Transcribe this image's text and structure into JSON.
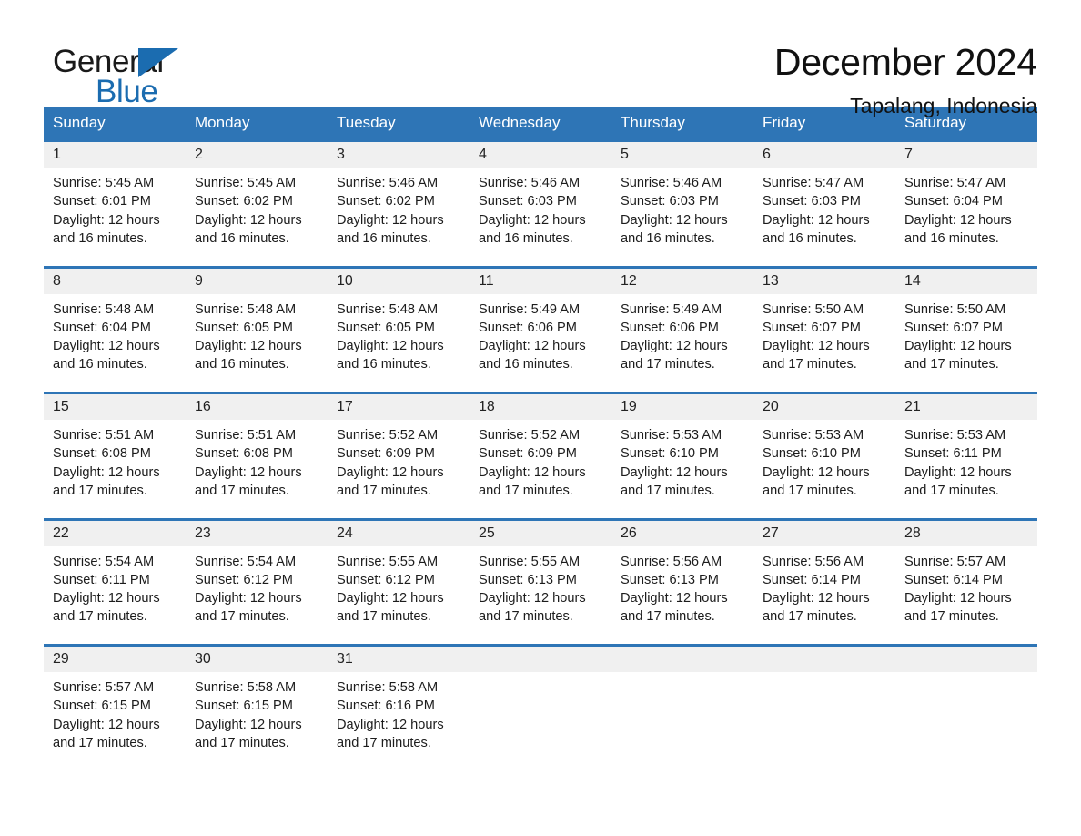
{
  "brand": {
    "word_one": "General",
    "word_two": "Blue",
    "accent_color": "#1b6cb0"
  },
  "header": {
    "title": "December 2024",
    "subtitle": "Tapalang, Indonesia"
  },
  "theme": {
    "header_blue": "#2e75b6",
    "daynum_background": "#f0f0f0",
    "text_color": "#1c1c1c"
  },
  "weekday_headers": [
    "Sunday",
    "Monday",
    "Tuesday",
    "Wednesday",
    "Thursday",
    "Friday",
    "Saturday"
  ],
  "labels": {
    "sunrise_prefix": "Sunrise:",
    "sunset_prefix": "Sunset:",
    "daylight_prefix": "Daylight:"
  },
  "weeks": [
    {
      "days": [
        {
          "date": "1",
          "sunrise": "Sunrise: 5:45 AM",
          "sunset": "Sunset: 6:01 PM",
          "daylight_line1": "Daylight: 12 hours",
          "daylight_line2": "and 16 minutes."
        },
        {
          "date": "2",
          "sunrise": "Sunrise: 5:45 AM",
          "sunset": "Sunset: 6:02 PM",
          "daylight_line1": "Daylight: 12 hours",
          "daylight_line2": "and 16 minutes."
        },
        {
          "date": "3",
          "sunrise": "Sunrise: 5:46 AM",
          "sunset": "Sunset: 6:02 PM",
          "daylight_line1": "Daylight: 12 hours",
          "daylight_line2": "and 16 minutes."
        },
        {
          "date": "4",
          "sunrise": "Sunrise: 5:46 AM",
          "sunset": "Sunset: 6:03 PM",
          "daylight_line1": "Daylight: 12 hours",
          "daylight_line2": "and 16 minutes."
        },
        {
          "date": "5",
          "sunrise": "Sunrise: 5:46 AM",
          "sunset": "Sunset: 6:03 PM",
          "daylight_line1": "Daylight: 12 hours",
          "daylight_line2": "and 16 minutes."
        },
        {
          "date": "6",
          "sunrise": "Sunrise: 5:47 AM",
          "sunset": "Sunset: 6:03 PM",
          "daylight_line1": "Daylight: 12 hours",
          "daylight_line2": "and 16 minutes."
        },
        {
          "date": "7",
          "sunrise": "Sunrise: 5:47 AM",
          "sunset": "Sunset: 6:04 PM",
          "daylight_line1": "Daylight: 12 hours",
          "daylight_line2": "and 16 minutes."
        }
      ]
    },
    {
      "days": [
        {
          "date": "8",
          "sunrise": "Sunrise: 5:48 AM",
          "sunset": "Sunset: 6:04 PM",
          "daylight_line1": "Daylight: 12 hours",
          "daylight_line2": "and 16 minutes."
        },
        {
          "date": "9",
          "sunrise": "Sunrise: 5:48 AM",
          "sunset": "Sunset: 6:05 PM",
          "daylight_line1": "Daylight: 12 hours",
          "daylight_line2": "and 16 minutes."
        },
        {
          "date": "10",
          "sunrise": "Sunrise: 5:48 AM",
          "sunset": "Sunset: 6:05 PM",
          "daylight_line1": "Daylight: 12 hours",
          "daylight_line2": "and 16 minutes."
        },
        {
          "date": "11",
          "sunrise": "Sunrise: 5:49 AM",
          "sunset": "Sunset: 6:06 PM",
          "daylight_line1": "Daylight: 12 hours",
          "daylight_line2": "and 16 minutes."
        },
        {
          "date": "12",
          "sunrise": "Sunrise: 5:49 AM",
          "sunset": "Sunset: 6:06 PM",
          "daylight_line1": "Daylight: 12 hours",
          "daylight_line2": "and 17 minutes."
        },
        {
          "date": "13",
          "sunrise": "Sunrise: 5:50 AM",
          "sunset": "Sunset: 6:07 PM",
          "daylight_line1": "Daylight: 12 hours",
          "daylight_line2": "and 17 minutes."
        },
        {
          "date": "14",
          "sunrise": "Sunrise: 5:50 AM",
          "sunset": "Sunset: 6:07 PM",
          "daylight_line1": "Daylight: 12 hours",
          "daylight_line2": "and 17 minutes."
        }
      ]
    },
    {
      "days": [
        {
          "date": "15",
          "sunrise": "Sunrise: 5:51 AM",
          "sunset": "Sunset: 6:08 PM",
          "daylight_line1": "Daylight: 12 hours",
          "daylight_line2": "and 17 minutes."
        },
        {
          "date": "16",
          "sunrise": "Sunrise: 5:51 AM",
          "sunset": "Sunset: 6:08 PM",
          "daylight_line1": "Daylight: 12 hours",
          "daylight_line2": "and 17 minutes."
        },
        {
          "date": "17",
          "sunrise": "Sunrise: 5:52 AM",
          "sunset": "Sunset: 6:09 PM",
          "daylight_line1": "Daylight: 12 hours",
          "daylight_line2": "and 17 minutes."
        },
        {
          "date": "18",
          "sunrise": "Sunrise: 5:52 AM",
          "sunset": "Sunset: 6:09 PM",
          "daylight_line1": "Daylight: 12 hours",
          "daylight_line2": "and 17 minutes."
        },
        {
          "date": "19",
          "sunrise": "Sunrise: 5:53 AM",
          "sunset": "Sunset: 6:10 PM",
          "daylight_line1": "Daylight: 12 hours",
          "daylight_line2": "and 17 minutes."
        },
        {
          "date": "20",
          "sunrise": "Sunrise: 5:53 AM",
          "sunset": "Sunset: 6:10 PM",
          "daylight_line1": "Daylight: 12 hours",
          "daylight_line2": "and 17 minutes."
        },
        {
          "date": "21",
          "sunrise": "Sunrise: 5:53 AM",
          "sunset": "Sunset: 6:11 PM",
          "daylight_line1": "Daylight: 12 hours",
          "daylight_line2": "and 17 minutes."
        }
      ]
    },
    {
      "days": [
        {
          "date": "22",
          "sunrise": "Sunrise: 5:54 AM",
          "sunset": "Sunset: 6:11 PM",
          "daylight_line1": "Daylight: 12 hours",
          "daylight_line2": "and 17 minutes."
        },
        {
          "date": "23",
          "sunrise": "Sunrise: 5:54 AM",
          "sunset": "Sunset: 6:12 PM",
          "daylight_line1": "Daylight: 12 hours",
          "daylight_line2": "and 17 minutes."
        },
        {
          "date": "24",
          "sunrise": "Sunrise: 5:55 AM",
          "sunset": "Sunset: 6:12 PM",
          "daylight_line1": "Daylight: 12 hours",
          "daylight_line2": "and 17 minutes."
        },
        {
          "date": "25",
          "sunrise": "Sunrise: 5:55 AM",
          "sunset": "Sunset: 6:13 PM",
          "daylight_line1": "Daylight: 12 hours",
          "daylight_line2": "and 17 minutes."
        },
        {
          "date": "26",
          "sunrise": "Sunrise: 5:56 AM",
          "sunset": "Sunset: 6:13 PM",
          "daylight_line1": "Daylight: 12 hours",
          "daylight_line2": "and 17 minutes."
        },
        {
          "date": "27",
          "sunrise": "Sunrise: 5:56 AM",
          "sunset": "Sunset: 6:14 PM",
          "daylight_line1": "Daylight: 12 hours",
          "daylight_line2": "and 17 minutes."
        },
        {
          "date": "28",
          "sunrise": "Sunrise: 5:57 AM",
          "sunset": "Sunset: 6:14 PM",
          "daylight_line1": "Daylight: 12 hours",
          "daylight_line2": "and 17 minutes."
        }
      ]
    },
    {
      "days": [
        {
          "date": "29",
          "sunrise": "Sunrise: 5:57 AM",
          "sunset": "Sunset: 6:15 PM",
          "daylight_line1": "Daylight: 12 hours",
          "daylight_line2": "and 17 minutes."
        },
        {
          "date": "30",
          "sunrise": "Sunrise: 5:58 AM",
          "sunset": "Sunset: 6:15 PM",
          "daylight_line1": "Daylight: 12 hours",
          "daylight_line2": "and 17 minutes."
        },
        {
          "date": "31",
          "sunrise": "Sunrise: 5:58 AM",
          "sunset": "Sunset: 6:16 PM",
          "daylight_line1": "Daylight: 12 hours",
          "daylight_line2": "and 17 minutes."
        },
        {
          "date": "",
          "sunrise": "",
          "sunset": "",
          "daylight_line1": "",
          "daylight_line2": ""
        },
        {
          "date": "",
          "sunrise": "",
          "sunset": "",
          "daylight_line1": "",
          "daylight_line2": ""
        },
        {
          "date": "",
          "sunrise": "",
          "sunset": "",
          "daylight_line1": "",
          "daylight_line2": ""
        },
        {
          "date": "",
          "sunrise": "",
          "sunset": "",
          "daylight_line1": "",
          "daylight_line2": ""
        }
      ]
    }
  ]
}
